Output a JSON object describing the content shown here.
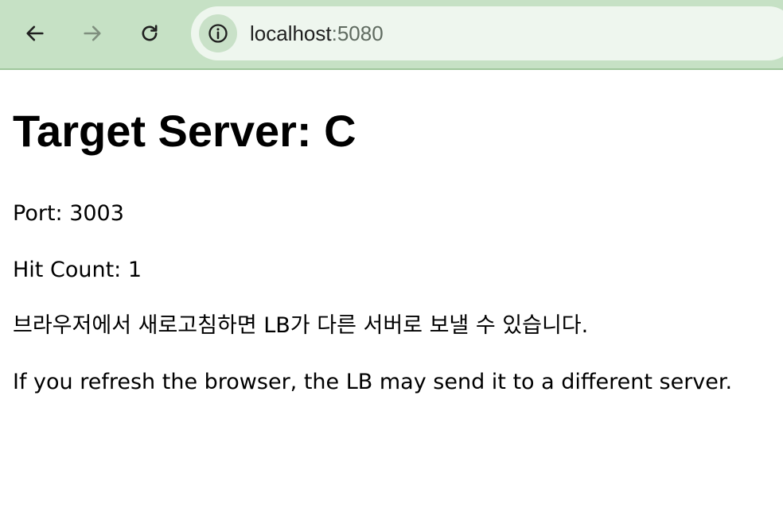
{
  "browser": {
    "url_host": "localhost",
    "url_port": ":5080"
  },
  "page": {
    "title": "Target Server: C",
    "port_line": "Port: 3003",
    "hit_count_line": "Hit Count: 1",
    "korean_note": "브라우저에서 새로고침하면 LB가 다른 서버로 보낼 수 있습니다.",
    "english_note": "If you refresh the browser, the LB may send it to a different server."
  },
  "icons": {
    "back": "arrow-left-icon",
    "forward": "arrow-right-icon",
    "reload": "reload-icon",
    "site_info": "info-icon"
  },
  "colors": {
    "toolbar_bg": "#c6e1c5",
    "omnibox_bg": "#eef6ee"
  }
}
